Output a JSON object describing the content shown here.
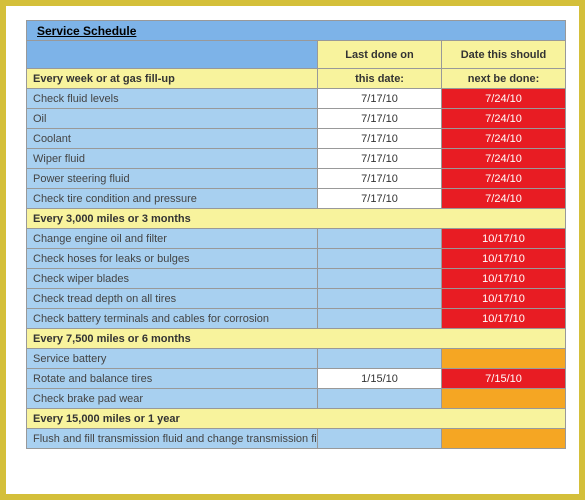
{
  "title": "Service Schedule",
  "header": {
    "last_done_top": "Last done on",
    "last_done_bottom": "this date:",
    "next_top": "Date this should",
    "next_bottom": "next be done:"
  },
  "sections": [
    {
      "label": "Every week or at gas fill-up",
      "rows": [
        {
          "task": "Check fluid levels",
          "last": "7/17/10",
          "next": "7/24/10",
          "next_style": "red"
        },
        {
          "task": "Oil",
          "last": "7/17/10",
          "next": "7/24/10",
          "next_style": "red"
        },
        {
          "task": "Coolant",
          "last": "7/17/10",
          "next": "7/24/10",
          "next_style": "red"
        },
        {
          "task": "Wiper fluid",
          "last": "7/17/10",
          "next": "7/24/10",
          "next_style": "red"
        },
        {
          "task": "Power steering fluid",
          "last": "7/17/10",
          "next": "7/24/10",
          "next_style": "red"
        },
        {
          "task": "Check tire condition and pressure",
          "last": "7/17/10",
          "next": "7/24/10",
          "next_style": "red"
        }
      ]
    },
    {
      "label": "Every 3,000 miles or 3 months",
      "rows": [
        {
          "task": "Change engine oil and filter",
          "last": "",
          "next": "10/17/10",
          "next_style": "red"
        },
        {
          "task": "Check hoses for leaks or bulges",
          "last": "",
          "next": "10/17/10",
          "next_style": "red"
        },
        {
          "task": "Check wiper blades",
          "last": "",
          "next": "10/17/10",
          "next_style": "red"
        },
        {
          "task": "Check tread depth on all tires",
          "last": "",
          "next": "10/17/10",
          "next_style": "red"
        },
        {
          "task": "Check battery terminals and cables for corrosion",
          "last": "",
          "next": "10/17/10",
          "next_style": "red"
        }
      ]
    },
    {
      "label": "Every 7,500 miles or 6 months",
      "rows": [
        {
          "task": "Service battery",
          "last": "",
          "next": "",
          "next_style": "orange"
        },
        {
          "task": "Rotate and balance tires",
          "last": "1/15/10",
          "next": "7/15/10",
          "next_style": "red"
        },
        {
          "task": "Check brake pad wear",
          "last": "",
          "next": "",
          "next_style": "orange"
        }
      ]
    },
    {
      "label": "Every 15,000 miles or 1 year",
      "rows": [
        {
          "task": "Flush and fill transmission fluid and change transmission filter",
          "last": "",
          "next": "",
          "next_style": "orange"
        }
      ]
    }
  ]
}
